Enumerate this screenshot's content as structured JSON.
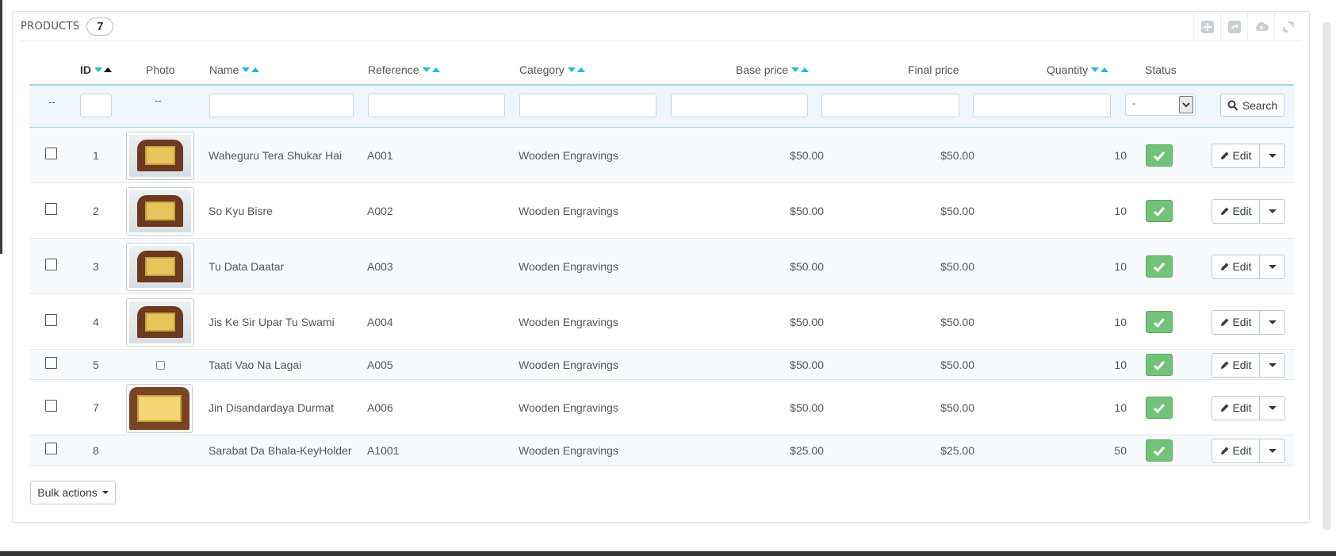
{
  "panel": {
    "title": "PRODUCTS",
    "count": "7"
  },
  "toolbar": [
    {
      "name": "add-new-button",
      "icon": "plus-square-icon"
    },
    {
      "name": "export-button",
      "icon": "share-icon"
    },
    {
      "name": "import-button",
      "icon": "cloud-upload-icon"
    },
    {
      "name": "refresh-button",
      "icon": "refresh-icon"
    }
  ],
  "headers": {
    "id": "ID",
    "photo": "Photo",
    "name": "Name",
    "reference": "Reference",
    "category": "Category",
    "base_price": "Base price",
    "final_price": "Final price",
    "quantity": "Quantity",
    "status": "Status"
  },
  "filters": {
    "checkbox_placeholder": "--",
    "photo_placeholder": "--",
    "status_selected": "-",
    "search_label": "Search"
  },
  "rows": [
    {
      "id": "1",
      "name": "Waheguru Tera Shukar Hai",
      "reference": "A001",
      "category": "Wooden Engravings",
      "base_price": "$50.00",
      "final_price": "$50.00",
      "quantity": "10",
      "photo": "thumb"
    },
    {
      "id": "2",
      "name": "So Kyu Bisre",
      "reference": "A002",
      "category": "Wooden Engravings",
      "base_price": "$50.00",
      "final_price": "$50.00",
      "quantity": "10",
      "photo": "thumb"
    },
    {
      "id": "3",
      "name": "Tu Data Daatar",
      "reference": "A003",
      "category": "Wooden Engravings",
      "base_price": "$50.00",
      "final_price": "$50.00",
      "quantity": "10",
      "photo": "thumb"
    },
    {
      "id": "4",
      "name": "Jis Ke Sir Upar Tu Swami",
      "reference": "A004",
      "category": "Wooden Engravings",
      "base_price": "$50.00",
      "final_price": "$50.00",
      "quantity": "10",
      "photo": "thumb"
    },
    {
      "id": "5",
      "name": "Taati Vao Na Lagai",
      "reference": "A005",
      "category": "Wooden Engravings",
      "base_price": "$50.00",
      "final_price": "$50.00",
      "quantity": "10",
      "photo": "broken"
    },
    {
      "id": "7",
      "name": "Jin Disandardaya Durmat",
      "reference": "A006",
      "category": "Wooden Engravings",
      "base_price": "$50.00",
      "final_price": "$50.00",
      "quantity": "10",
      "photo": "thumb-large"
    },
    {
      "id": "8",
      "name": "Sarabat Da Bhala-KeyHolder",
      "reference": "A1001",
      "category": "Wooden Engravings",
      "base_price": "$25.00",
      "final_price": "$25.00",
      "quantity": "50",
      "photo": "none"
    }
  ],
  "row_actions": {
    "edit_label": "Edit"
  },
  "bulk_actions_label": "Bulk actions",
  "colors": {
    "accent": "#25b9d7",
    "status_ok": "#72c279",
    "filter_bg": "#eff6fb"
  }
}
